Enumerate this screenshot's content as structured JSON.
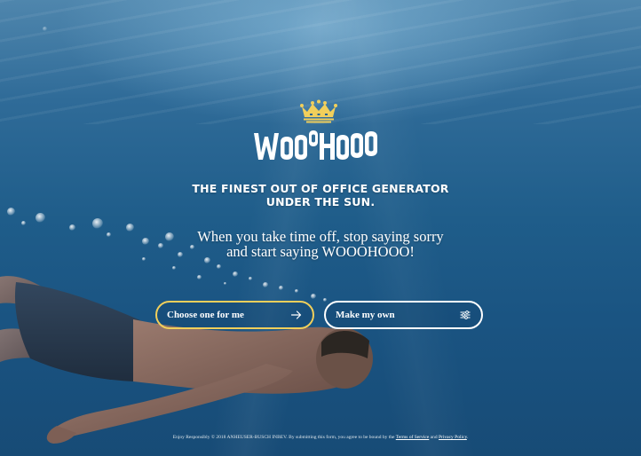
{
  "brand": {
    "logo_name": "crown-logo-icon",
    "wordmark": "WooOHooo",
    "accent_color": "#f1cf5b"
  },
  "hero": {
    "tagline_line1": "THE FINEST OUT OF OFFICE GENERATOR",
    "tagline_line2": "UNDER THE SUN.",
    "subtitle_line1": "When you take time off, stop saying sorry",
    "subtitle_line2": "and start saying WOOOHOOO!"
  },
  "actions": {
    "choose_label": "Choose one for me",
    "choose_icon": "arrow-right-icon",
    "make_label": "Make my own",
    "make_icon": "sliders-icon"
  },
  "footer": {
    "text": "Enjoy Responsibly © 2018 ANHEUSER-BUSCH INBEV. By submitting this form, you agree to be bound by the",
    "terms_link": "Terms of Service",
    "conjunction": "and",
    "privacy_link": "Privacy Policy",
    "end": "."
  }
}
